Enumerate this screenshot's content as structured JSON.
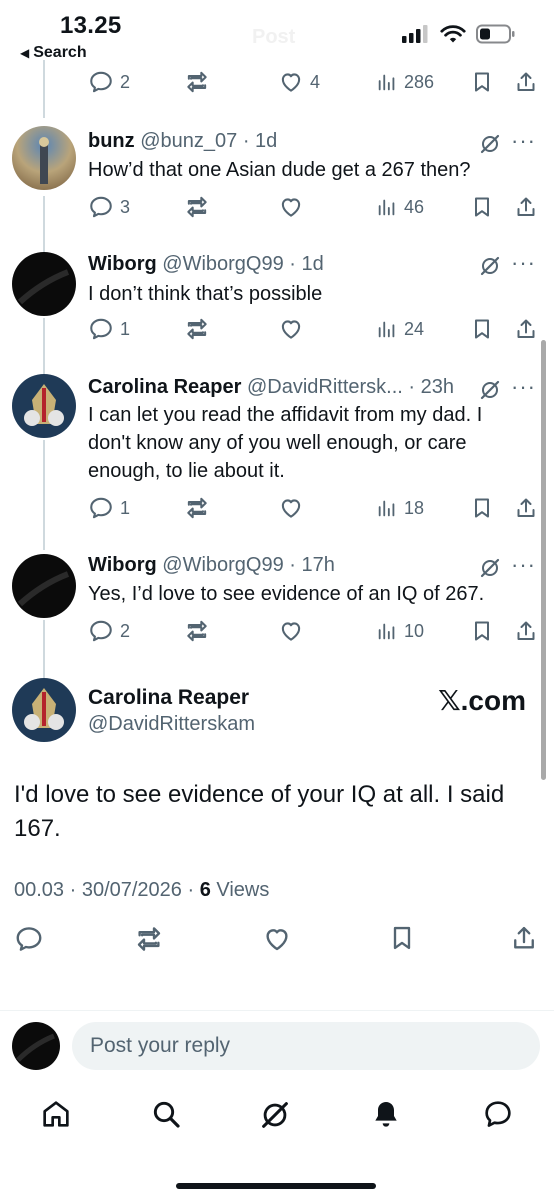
{
  "status": {
    "time": "13.25",
    "back_label": "Search",
    "faint_title": "Post"
  },
  "top_row": {
    "replies": "2",
    "likes": "4",
    "views": "286"
  },
  "tweets": [
    {
      "name": "bunz",
      "handle": "@bunz_07",
      "time": "1d",
      "text": "How’d that one Asian dude get a 267 then?",
      "replies": "3",
      "views": "46"
    },
    {
      "name": "Wiborg",
      "handle": "@WiborgQ99",
      "time": "1d",
      "text": "I don’t think that’s possible",
      "replies": "1",
      "views": "24"
    },
    {
      "name": "Carolina Reaper",
      "handle": "@DavidRittersk...",
      "time": "23h",
      "text": "I can let you read the affidavit from my dad.  I don't know any of you well enough, or care enough, to lie about it.",
      "replies": "1",
      "views": "18"
    },
    {
      "name": "Wiborg",
      "handle": "@WiborgQ99",
      "time": "17h",
      "text": "Yes, I’d love to see evidence of an IQ of 267.",
      "replies": "2",
      "views": "10"
    }
  ],
  "main_post": {
    "name": "Carolina Reaper",
    "handle": "@DavidRitterskam",
    "watermark": "𝕏.com",
    "text": "I'd love to see evidence of your IQ at all.  I said 167.",
    "timestamp": "00.03 · 30/07/2026 · ",
    "views_count": "6",
    "views_label": " Views"
  },
  "reply": {
    "placeholder": "Post your reply"
  },
  "colors": {
    "text": "#0f1419",
    "muted": "#536471",
    "line": "#cfd9de"
  },
  "icons": [
    "reply-icon",
    "retweet-icon",
    "like-icon",
    "views-icon",
    "bookmark-icon",
    "share-icon",
    "grok-icon",
    "more-icon",
    "home-icon",
    "search-icon",
    "notifications-icon",
    "messages-icon"
  ]
}
